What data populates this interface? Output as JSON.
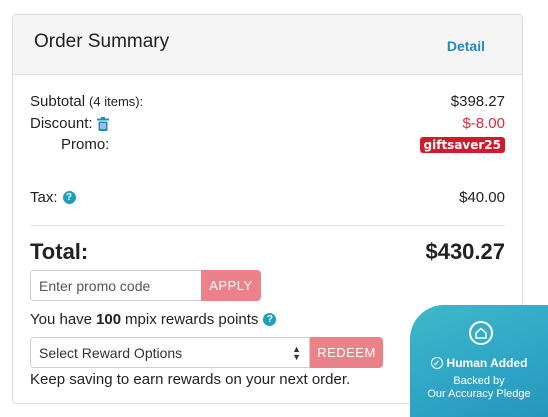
{
  "header": {
    "title": "Order Summary",
    "detail_link": "Detail"
  },
  "subtotal": {
    "label": "Subtotal",
    "items_note": "(4 items):",
    "value": "$398.27"
  },
  "discount": {
    "label": "Discount:",
    "value": "$-8.00"
  },
  "promo": {
    "label": "Promo:",
    "code": "giftsaver25"
  },
  "tax": {
    "label": "Tax:",
    "value": "$40.00"
  },
  "total": {
    "label": "Total:",
    "value": "$430.27"
  },
  "promo_input": {
    "placeholder": "Enter promo code",
    "apply_label": "APPLY"
  },
  "rewards": {
    "prefix": "You have",
    "points": "100",
    "suffix": "mpix rewards points"
  },
  "reward_select": {
    "selected": "Select Reward Options",
    "redeem_label": "REDEEM"
  },
  "keep_saving": "Keep saving to earn rewards on your next order.",
  "pledge": {
    "title": "Human Added",
    "line1": "Backed by",
    "line2": "Our Accuracy Pledge"
  },
  "colors": {
    "accent_link": "#1e8bc3",
    "discount_red": "#e0283e",
    "button_pink": "#ec8289",
    "pledge_teal": "#2fa6c6"
  },
  "icons": {
    "discount": "trash-icon",
    "tax": "help-icon",
    "rewards": "help-icon",
    "pledge": "shield-home-icon"
  }
}
